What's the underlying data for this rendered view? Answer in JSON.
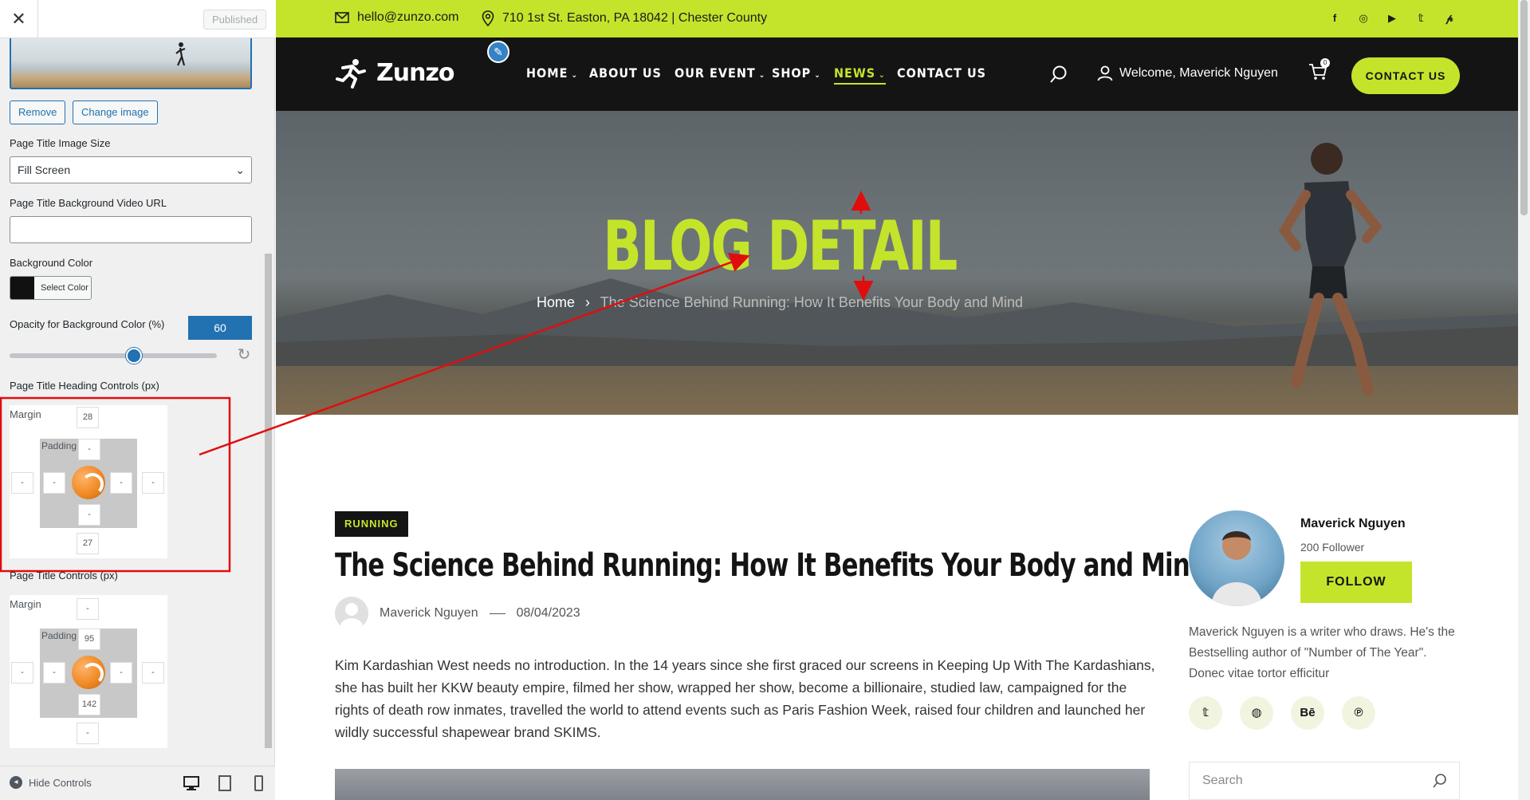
{
  "panel": {
    "status": "Published",
    "remove_label": "Remove",
    "change_image_label": "Change image",
    "image_size_label": "Page Title Image Size",
    "image_size_value": "Fill Screen",
    "video_url_label": "Page Title Background Video URL",
    "video_url_value": "",
    "bg_color_label": "Background Color",
    "select_color_label": "Select Color",
    "bg_color": "#111111",
    "opacity_label": "Opacity for Background Color (%)",
    "opacity_value": "60",
    "opacity_fraction": 0.6,
    "heading_controls_label": "Page Title Heading Controls (px)",
    "heading_margin": {
      "label": "Margin",
      "top": "28",
      "right": "-",
      "bottom": "27",
      "left": "-"
    },
    "heading_padding": {
      "label": "Padding",
      "top": "-",
      "right": "-",
      "bottom": "-",
      "left": "-"
    },
    "title_controls_label": "Page Title Controls (px)",
    "title_margin": {
      "label": "Margin",
      "top": "-",
      "right": "-",
      "bottom": "-",
      "left": "-"
    },
    "title_padding": {
      "label": "Padding",
      "top": "95",
      "right": "-",
      "bottom": "142",
      "left": "-"
    },
    "hide_controls": "Hide Controls"
  },
  "topbar": {
    "email": "hello@zunzo.com",
    "address": "710 1st St. Easton, PA 18042 | Chester County",
    "socials": [
      "facebook-icon",
      "instagram-icon",
      "youtube-icon",
      "twitter-icon",
      "pinterest-icon"
    ],
    "bg": "#c4e42b"
  },
  "nav": {
    "brand": "Zunzo",
    "items": [
      "HOME",
      "ABOUT US",
      "OUR EVENT",
      "SHOP",
      "NEWS",
      "CONTACT US"
    ],
    "active": "NEWS",
    "welcome": "Welcome, Maverick Nguyen",
    "cart_count": "0",
    "cta": "CONTACT US"
  },
  "hero": {
    "title": "BLOG DETAIL",
    "crumb_home": "Home",
    "crumb_current": "The Science Behind Running: How It Benefits Your Body and Mind"
  },
  "post": {
    "category": "RUNNING",
    "title": "The Science Behind Running: How It Benefits Your Body and Mind",
    "author": "Maverick Nguyen",
    "date": "08/04/2023",
    "body": "Kim Kardashian West needs no introduction. In the 14 years since she first graced our screens in Keeping Up With The Kardashians, she has built her KKW beauty empire, filmed her show, wrapped her show, become a billionaire, studied law, campaigned for the rights of death row inmates, travelled the world to attend events such as Paris Fashion Week, raised four children and launched her wildly successful shapewear brand SKIMS."
  },
  "sidebar": {
    "name": "Maverick Nguyen",
    "followers": "200 Follower",
    "follow": "FOLLOW",
    "bio": "Maverick Nguyen is a writer who draws. He's the Bestselling author of \"Number of The Year\". Donec vitae tortor efficitur",
    "socials": [
      "twitter-icon",
      "dribbble-icon",
      "behance-icon",
      "pinterest-icon"
    ],
    "search_placeholder": "Search"
  },
  "colors": {
    "accent": "#c4e42b",
    "dark": "#141414",
    "wp_blue": "#2271b1",
    "annotation": "#e10d0d"
  }
}
